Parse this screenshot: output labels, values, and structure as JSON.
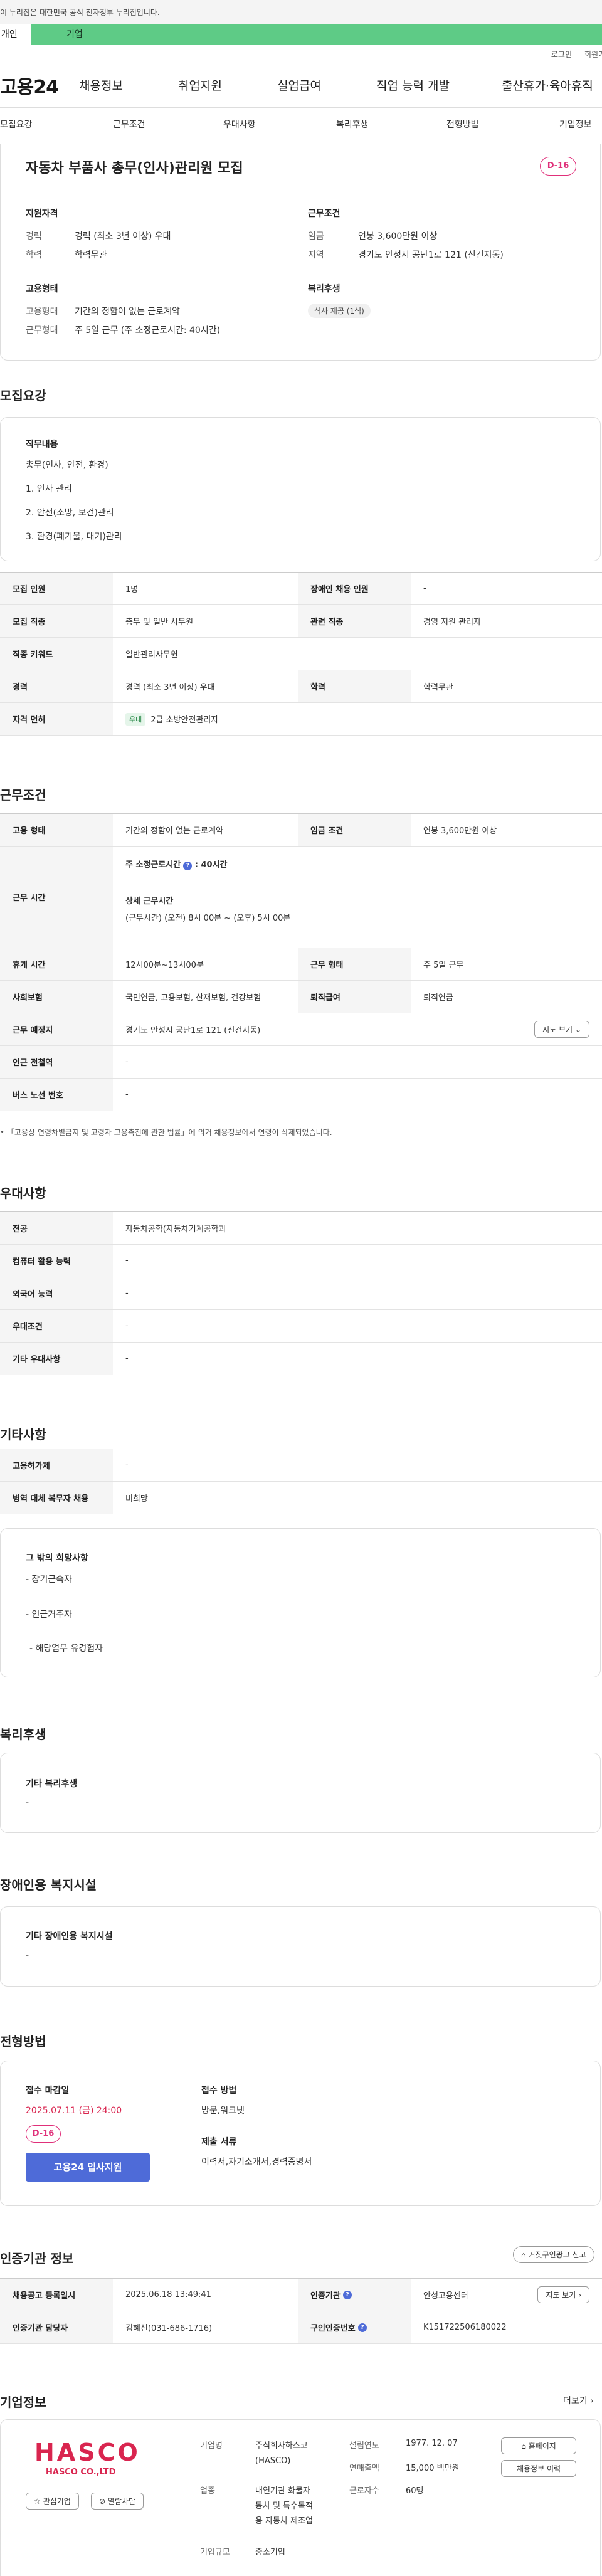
{
  "topbar": {
    "notice": "이 누리집은 대한민국 공식 전자정부 누리집입니다."
  },
  "usertabs": {
    "individual": "개인",
    "business": "기업"
  },
  "util": {
    "login": "로그인",
    "signup": "회원가입"
  },
  "gnb": {
    "logo": "고용24",
    "items": [
      "채용정보",
      "취업지원",
      "실업급여",
      "직업 능력 개발",
      "출산휴가·육아휴직"
    ]
  },
  "snb": {
    "items": [
      "모집요강",
      "근무조건",
      "우대사항",
      "복리후생",
      "전형방법",
      "기업정보"
    ]
  },
  "summary": {
    "title": "자동차 부품사 총무(인사)관리원 모집",
    "dday": "D-16",
    "qual_h": "지원자격",
    "cond_h": "근무조건",
    "career_l": "경력",
    "career_v": "경력 (최소 3년 이상) 우대",
    "edu_l": "학력",
    "edu_v": "학력무관",
    "wage_l": "임금",
    "wage_v": "연봉 3,600만원 이상",
    "region_l": "지역",
    "region_v": "경기도 안성시 공단1로 121 (신건지동)",
    "emp_h": "고용형태",
    "welfare_h": "복리후생",
    "emptype_l": "고용형태",
    "emptype_v": "기간의 정함이 없는 근로계약",
    "worktype_l": "근무형태",
    "worktype_v": "주 5일 근무 (주 소정근로시간: 40시간)",
    "welfare_chip": "식사 제공 (1식)"
  },
  "recruit": {
    "section": "모집요강",
    "duty_h": "직무내용",
    "duty_lines": [
      "총무(인사, 안전, 환경)",
      "1. 인사 관리",
      "2. 안전(소방, 보건)관리",
      "3. 환경(폐기물, 대기)관리"
    ],
    "rows": [
      {
        "l1": "모집 인원",
        "v1": "1명",
        "l2": "장애인 채용 인원",
        "v2": "-"
      },
      {
        "l1": "모집 직종",
        "v1": "총무 및 일반 사무원",
        "l2": "관련 직종",
        "v2": "경영 지원 관리자"
      },
      {
        "l1": "직종 키워드",
        "v1": "일반관리사무원"
      },
      {
        "l1": "경력",
        "v1": "경력 (최소 3년 이상) 우대",
        "l2": "학력",
        "v2": "학력무관"
      },
      {
        "l1": "자격 면허",
        "chip": "우대",
        "v1": "2급 소방안전관리자"
      }
    ]
  },
  "work": {
    "section": "근무조건",
    "emp_l": "고용 형태",
    "emp_v": "기간의 정함이 없는 근로계약",
    "wage_l": "임금 조건",
    "wage_v": "연봉 3,600만원 이상",
    "hours_l": "근무 시간",
    "hours_main": "주 소정근로시간",
    "hours_q": "?",
    "hours_main_v": ": 40시간",
    "hours_detail_h": "상세 근무시간",
    "hours_detail": "(근무시간) (오전) 8시 00분 ~ (오후) 5시 00분",
    "break_l": "휴게 시간",
    "break_v": "12시00분~13시00분",
    "wtype_l": "근무 형태",
    "wtype_v": "주 5일 근무",
    "ins_l": "사회보험",
    "ins_v": "국민연금, 고용보험, 산재보험, 건강보험",
    "sev_l": "퇴직급여",
    "sev_v": "퇴직연금",
    "place_l": "근무 예정지",
    "place_v": "경기도 안성시 공단1로 121 (신건지동)",
    "map_btn": "지도 보기",
    "station_l": "인근 전철역",
    "station_v": "-",
    "bus_l": "버스 노선 번호",
    "bus_v": "-",
    "note": "「고용상 연령차별금지 및 고령자 고용촉진에 관한 법률」에 의거 채용정보에서 연령이 삭제되었습니다."
  },
  "pref": {
    "section": "우대사항",
    "rows": [
      {
        "l": "전공",
        "v": "자동차공학(자동차기계공학과"
      },
      {
        "l": "컴퓨터 활용 능력",
        "v": "-"
      },
      {
        "l": "외국어 능력",
        "v": "-"
      },
      {
        "l": "우대조건",
        "v": "-"
      },
      {
        "l": "기타 우대사항",
        "v": "-"
      }
    ]
  },
  "etc": {
    "section": "기타사항",
    "rows": [
      {
        "l": "고용허가제",
        "v": "-"
      },
      {
        "l": "병역 대체 복무자 채용",
        "v": "비희망"
      }
    ],
    "box_h": "그 밖의 희망사항",
    "box_lines": [
      "- 장기근속자",
      "- 인근거주자",
      "- 해당업무 유경험자"
    ]
  },
  "welfare": {
    "section": "복리후생",
    "box_h": "기타 복리후생",
    "box_v": "-"
  },
  "disability": {
    "section": "장애인용 복지시설",
    "box_h": "기타 장애인용 복지시설",
    "box_v": "-"
  },
  "process": {
    "section": "전형방법",
    "deadline_h": "접수 마감일",
    "deadline_v": "2025.07.11 (금) 24:00",
    "dday": "D-16",
    "apply_btn": "고용24 입사지원",
    "method_h": "접수 방법",
    "method_v": "방문,워크넷",
    "docs_h": "제출 서류",
    "docs_v": "이력서,자기소개서,경력증명서"
  },
  "cert": {
    "section": "인증기관 정보",
    "report_btn": "거짓구인광고 신고",
    "r1": {
      "l1": "채용공고 등록일시",
      "v1": "2025.06.18 13:49:41",
      "l2": "인증기관",
      "v2": "안성고용센터",
      "btn": "지도 보기"
    },
    "r2": {
      "l1": "인증기관 담당자",
      "v1": "김혜선(031-686-1716)",
      "l2": "구인인증번호",
      "v2": "K151722506180022"
    }
  },
  "company": {
    "section": "기업정보",
    "more": "더보기",
    "logo": "HASCO",
    "logo_sub": "HASCO CO.,LTD",
    "fav_btn": "관심기업",
    "block_btn": "열람차단",
    "name_l": "기업명",
    "name_v": [
      "주식회사하스코",
      "(HASCO)"
    ],
    "biz_l": "업종",
    "biz_v": [
      "내연기관 화물자",
      "동차 및 특수목적",
      "용 자동차 제조업"
    ],
    "size_l": "기업규모",
    "size_v": "중소기업",
    "est_l": "설립연도",
    "est_v": "1977. 12. 07",
    "sales_l": "연매출액",
    "sales_v": "15,000 백만원",
    "emp_l": "근로자수",
    "emp_v": "60명",
    "home_btn": "홈페이지",
    "jobs_btn": "채용정보 이력"
  },
  "colors": {
    "green": "#5ecb86",
    "pink": "#e0307a",
    "blue": "#4e6bd8",
    "red": "#d9254f"
  }
}
